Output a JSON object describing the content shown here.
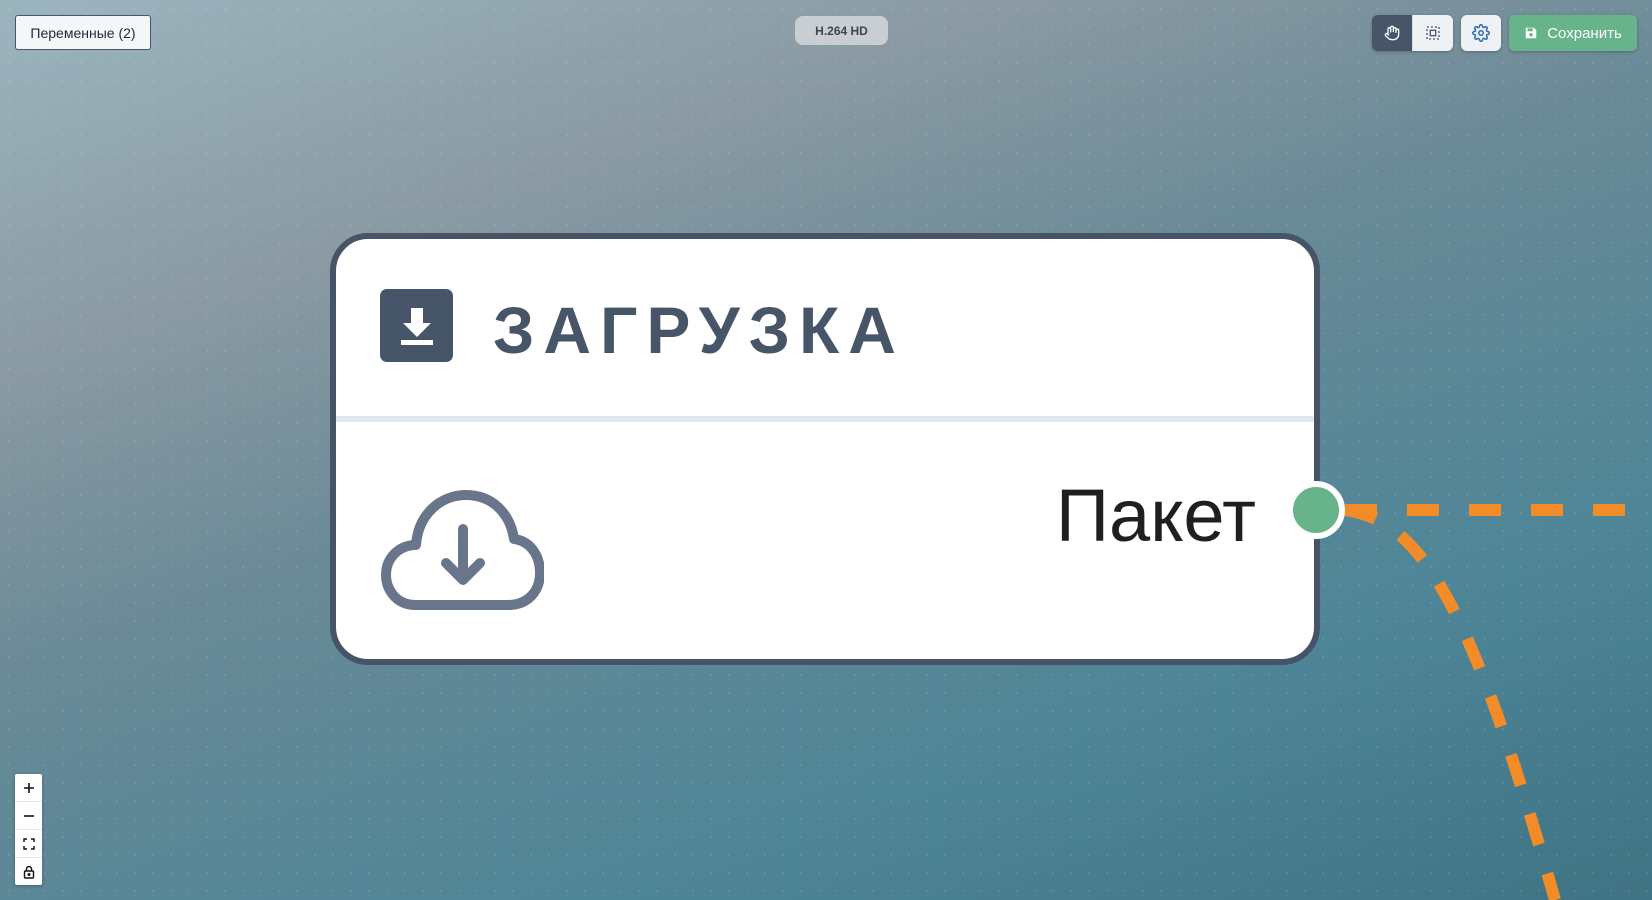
{
  "toolbar": {
    "variables_button": "Переменные (2)",
    "format_badge": "H.264 HD",
    "pan_tool_icon": "hand-icon",
    "select_tool_icon": "selection-box-icon",
    "settings_icon": "gear-icon",
    "save_label": "Сохранить",
    "save_icon": "floppy-disk-icon"
  },
  "node": {
    "title": "ЗАГРУЗКА",
    "header_icon": "download-icon",
    "body_icon": "cloud-download-icon",
    "output_label": "Пакет",
    "output_port_color": "#68b48a",
    "border_color": "#475467"
  },
  "edges": {
    "color": "#f28c28",
    "style": "dashed"
  },
  "zoom_controls": {
    "items": [
      "zoom-in-icon",
      "zoom-out-icon",
      "fit-view-icon",
      "lock-icon"
    ]
  }
}
